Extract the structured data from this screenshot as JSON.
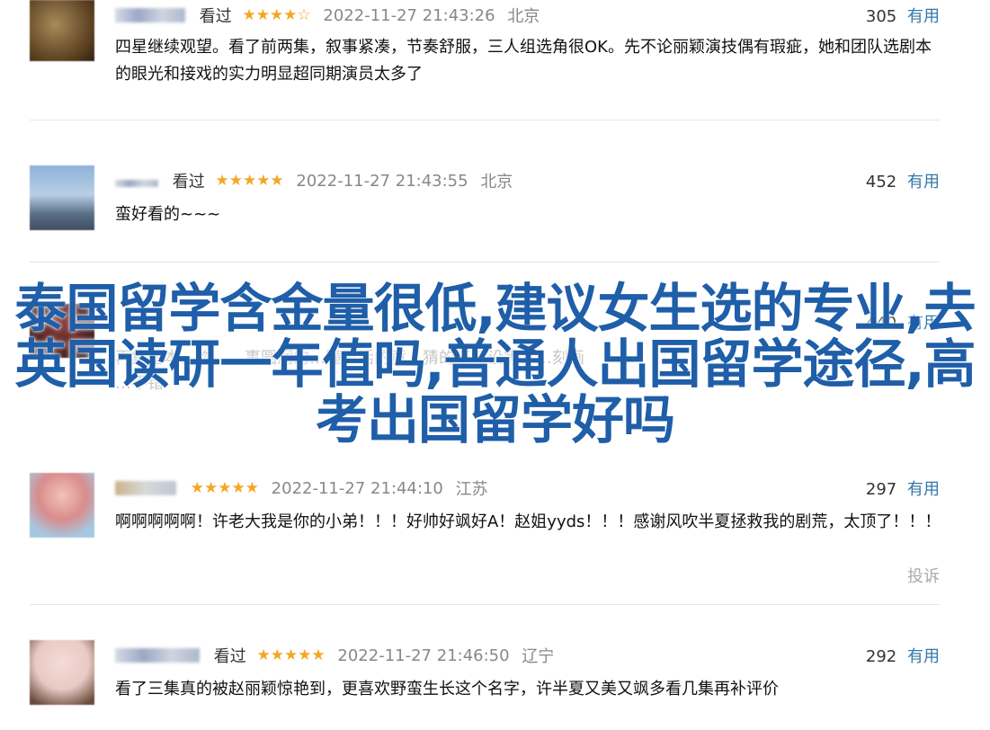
{
  "comments": [
    {
      "watched": "看过",
      "stars": "★★★★☆",
      "time": "2022-11-27 21:43:26",
      "location": "北京",
      "votes": "305",
      "useful": "有用",
      "text": "四星继续观望。看了前两集，叙事紧凑，节奏舒服，三人组选角很OK。先不论丽颖演技偶有瑕疵，她和团队选剧本的眼光和接戏的实力明显超同期演员太多了",
      "avatar_color": "#6b4f2a"
    },
    {
      "watched": "看过",
      "stars": "★★★★★",
      "time": "2022-11-27 21:43:55",
      "location": "北京",
      "votes": "452",
      "useful": "有用",
      "text": "蛮好看的~~~",
      "avatar_color": "#6d8fb8"
    },
    {
      "stars": "★★★★★",
      "time": "2022-11-27 21:44:10",
      "location": "江苏",
      "votes": "297",
      "useful": "有用",
      "text": "啊啊啊啊啊！许老大我是你的小弟！！！好帅好飒好A！赵姐yyds！！！感谢风吹半夏拯救我的剧荒，太顶了！！！",
      "report": "投诉",
      "avatar_color": "#d98c8c"
    },
    {
      "watched": "看过",
      "stars": "★★★★★",
      "time": "2022-11-27 21:46:50",
      "location": "辽宁",
      "votes": "292",
      "useful": "有用",
      "text": "看了三集真的被赵丽颖惊艳到，更喜欢野蛮生长这个名字，许半夏又美又飒多看几集再补评价",
      "avatar_color": "#e9c9c3"
    }
  ],
  "hidden_comment": {
    "votes": "440",
    "useful": "有用",
    "partial_text_1": "再集基本…物，…事圆润的…瞳听话的童…猜的伍建设等，…刻画",
    "partial_text_2": "…不错"
  },
  "overlay_title": "泰国留学含金量很低,建议女生选的专业,去英国读研一年值吗,普通人出国留学途径,高考出国留学好吗"
}
